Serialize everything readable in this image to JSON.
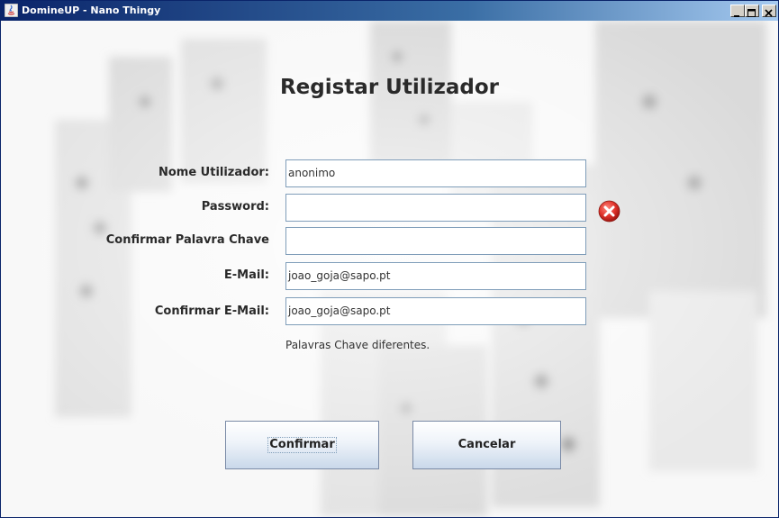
{
  "window": {
    "title": "DomineUP - Nano Thingy"
  },
  "form": {
    "heading": "Registar Utilizador",
    "fields": [
      {
        "label": "Nome Utilizador:",
        "value": "anonimo"
      },
      {
        "label": "Password:",
        "value": ""
      },
      {
        "label": "Confirmar Palavra Chave",
        "value": ""
      },
      {
        "label": "E-Mail:",
        "value": "joao_goja@sapo.pt"
      },
      {
        "label": "Confirmar E-Mail:",
        "value": "joao_goja@sapo.pt"
      }
    ],
    "error_message": "Palavras Chave diferentes.",
    "error_icon": "error-x-icon"
  },
  "buttons": {
    "confirm_label": "Confirmar",
    "cancel_label": "Cancelar"
  },
  "colors": {
    "titlebar": "#0a246a",
    "error": "#d42a2a"
  }
}
